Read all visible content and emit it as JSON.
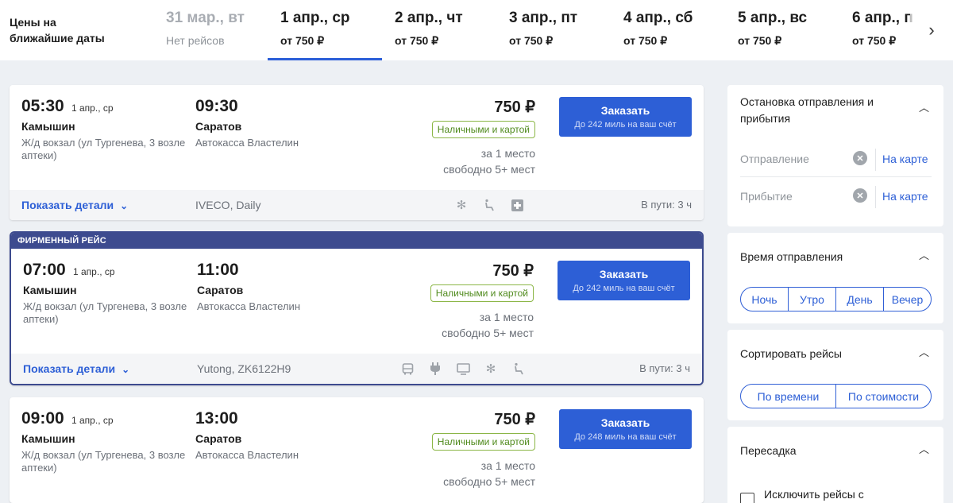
{
  "date_strip": {
    "title_line1": "Цены на",
    "title_line2": "ближайшие даты",
    "tabs": [
      {
        "date": "31 мар., вт",
        "price": "Нет рейсов"
      },
      {
        "date": "1 апр., ср",
        "price": "от 750 ₽"
      },
      {
        "date": "2 апр., чт",
        "price": "от 750 ₽"
      },
      {
        "date": "3 апр., пт",
        "price": "от 750 ₽"
      },
      {
        "date": "4 апр., сб",
        "price": "от 750 ₽"
      },
      {
        "date": "5 апр., вс",
        "price": "от 750 ₽"
      },
      {
        "date": "6 апр., п",
        "price": "от 750 ₽"
      }
    ],
    "active_tab": "1 апр., ср",
    "next_icon": "chevron-right-icon"
  },
  "trips": [
    {
      "dep_time": "05:30",
      "dep_date": "1 апр., ср",
      "dep_city": "Камышин",
      "dep_stop": "Ж/д вокзал (ул Тургенева, 3 возле аптеки)",
      "arr_time": "09:30",
      "arr_city": "Саратов",
      "arr_stop": "Автокасса Властелин",
      "price": "750 ₽",
      "payment": "Наличными и картой",
      "seat_price_note": "за 1 место",
      "seats_free": "свободно 5+ мест",
      "order_label": "Заказать",
      "miles": "До 242 миль на ваш счёт",
      "details_label": "Показать детали",
      "bus": "IVECO, Daily",
      "amenities": [
        "snowflake-icon",
        "reclining-seat-icon",
        "first-aid-icon"
      ],
      "duration": "В пути: 3 ч"
    },
    {
      "brand_label": "ФИРМЕННЫЙ РЕЙС",
      "dep_time": "07:00",
      "dep_date": "1 апр., ср",
      "dep_city": "Камышин",
      "dep_stop": "Ж/д вокзал (ул Тургенева, 3 возле аптеки)",
      "arr_time": "11:00",
      "arr_city": "Саратов",
      "arr_stop": "Автокасса Властелин",
      "price": "750 ₽",
      "payment": "Наличными и картой",
      "seat_price_note": "за 1 место",
      "seats_free": "свободно 5+ мест",
      "order_label": "Заказать",
      "miles": "До 242 миль на ваш счёт",
      "details_label": "Показать детали",
      "bus": "Yutong, ZK6122H9",
      "amenities": [
        "bus-icon",
        "power-socket-icon",
        "tv-icon",
        "snowflake-icon",
        "reclining-seat-icon"
      ],
      "duration": "В пути: 3 ч"
    },
    {
      "dep_time": "09:00",
      "dep_date": "1 апр., ср",
      "dep_city": "Камышин",
      "dep_stop": "Ж/д вокзал (ул Тургенева, 3 возле аптеки)",
      "arr_time": "13:00",
      "arr_city": "Саратов",
      "arr_stop": "Автокасса Властелин",
      "price": "750 ₽",
      "payment": "Наличными и картой",
      "seat_price_note": "за 1 место",
      "seats_free": "свободно 5+ мест",
      "order_label": "Заказать",
      "miles": "До 248 миль на ваш счёт"
    }
  ],
  "filters": {
    "stops": {
      "title": "Остановка отправления и прибытия",
      "departure_placeholder": "Отправление",
      "arrival_placeholder": "Прибытие",
      "map_link": "На карте"
    },
    "dep_time": {
      "title": "Время отправления",
      "options": [
        "Ночь",
        "Утро",
        "День",
        "Вечер"
      ]
    },
    "sort": {
      "title": "Сортировать рейсы",
      "options": [
        "По времени",
        "По стоимости"
      ]
    },
    "transfer": {
      "title": "Пересадка",
      "exclude_label": "Исключить рейсы с"
    }
  },
  "colors": {
    "accent": "#2d5fd6",
    "brand_header": "#3d4b8f",
    "payment_badge": "#8bb646",
    "page_bg": "#edf0f4"
  }
}
